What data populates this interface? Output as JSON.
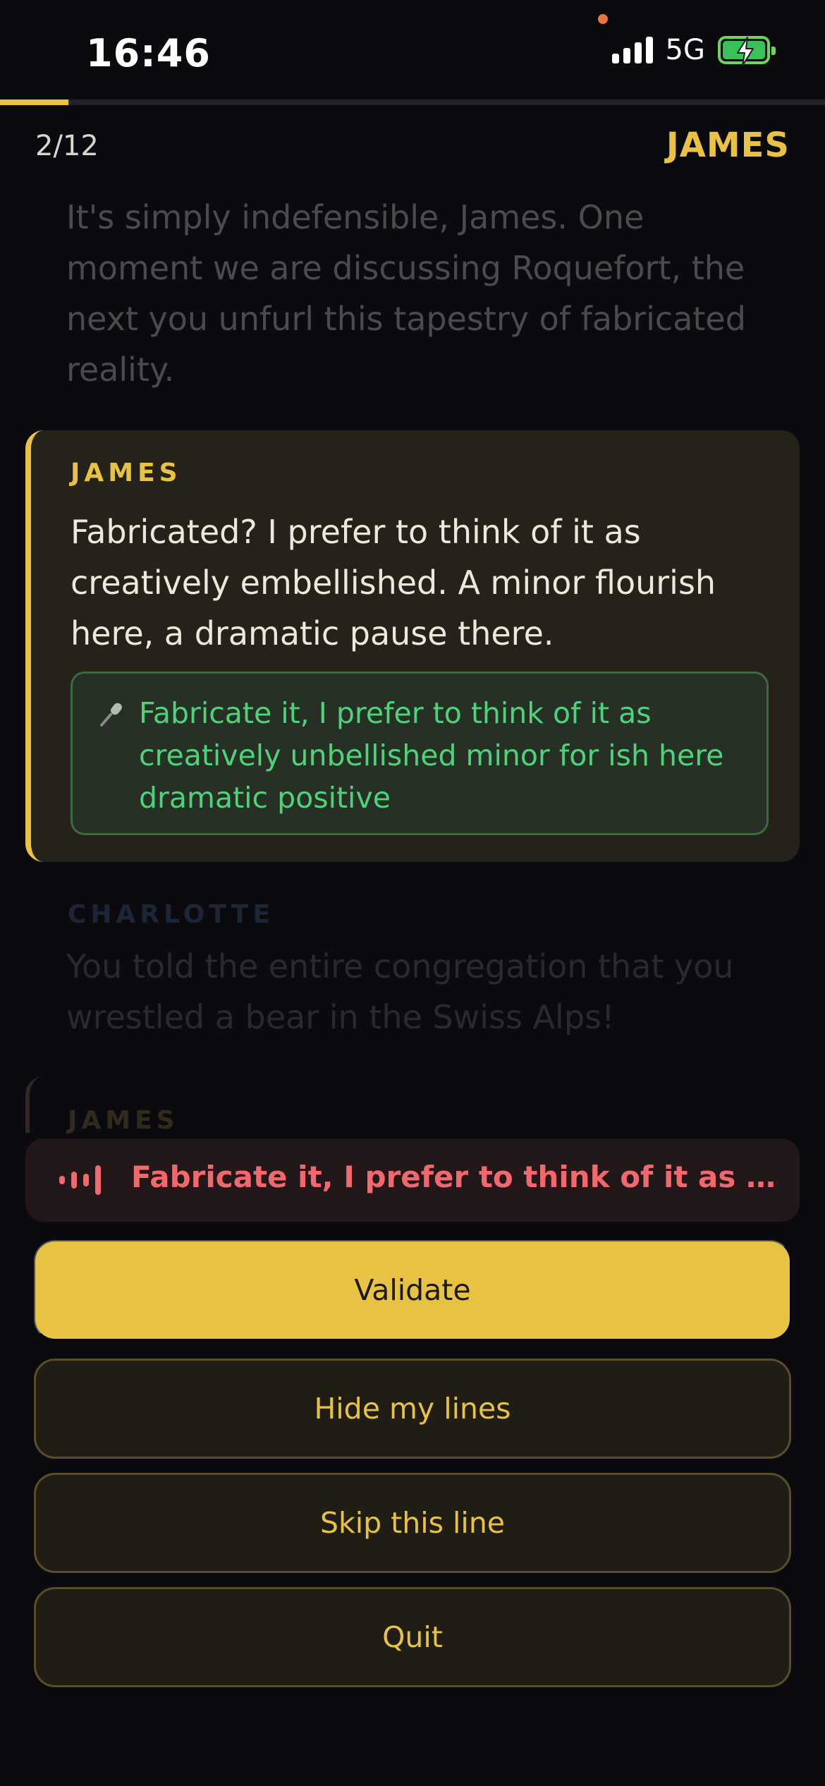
{
  "status_bar": {
    "time": "16:46",
    "network": "5G"
  },
  "header": {
    "progress_counter": "2/12",
    "progress_fraction": 0.083,
    "role": "JAMES"
  },
  "script": {
    "previous_line": "It's simply indefensible, James. One moment we are discussing Roquefort, the next you unfurl this tapestry of fabricated reality.",
    "active": {
      "speaker": "JAMES",
      "text": "Fabricated? I prefer to think of it as creatively embellished. A minor flourish here, a dramatic pause there.",
      "transcript": "Fabricate it, I prefer to think of it as creatively unbellished minor for ish here dramatic positive"
    },
    "next": {
      "speaker": "CHARLOTTE",
      "text": "You told the entire congregation that you wrestled a bear in the Swiss Alps!"
    },
    "following_speaker": "JAMES"
  },
  "live_transcript": "Fabricate it, I prefer to think of it as creat...",
  "actions": {
    "validate": "Validate",
    "hide_lines": "Hide my lines",
    "skip_line": "Skip this line",
    "quit": "Quit"
  },
  "colors": {
    "accent": "#e8c343",
    "transcript_green": "#4ed27a",
    "live_red": "#f2686c",
    "background": "#0b0b0f"
  },
  "icons": [
    "signal-icon",
    "battery-charging-icon",
    "microphone-icon",
    "waveform-icon"
  ]
}
